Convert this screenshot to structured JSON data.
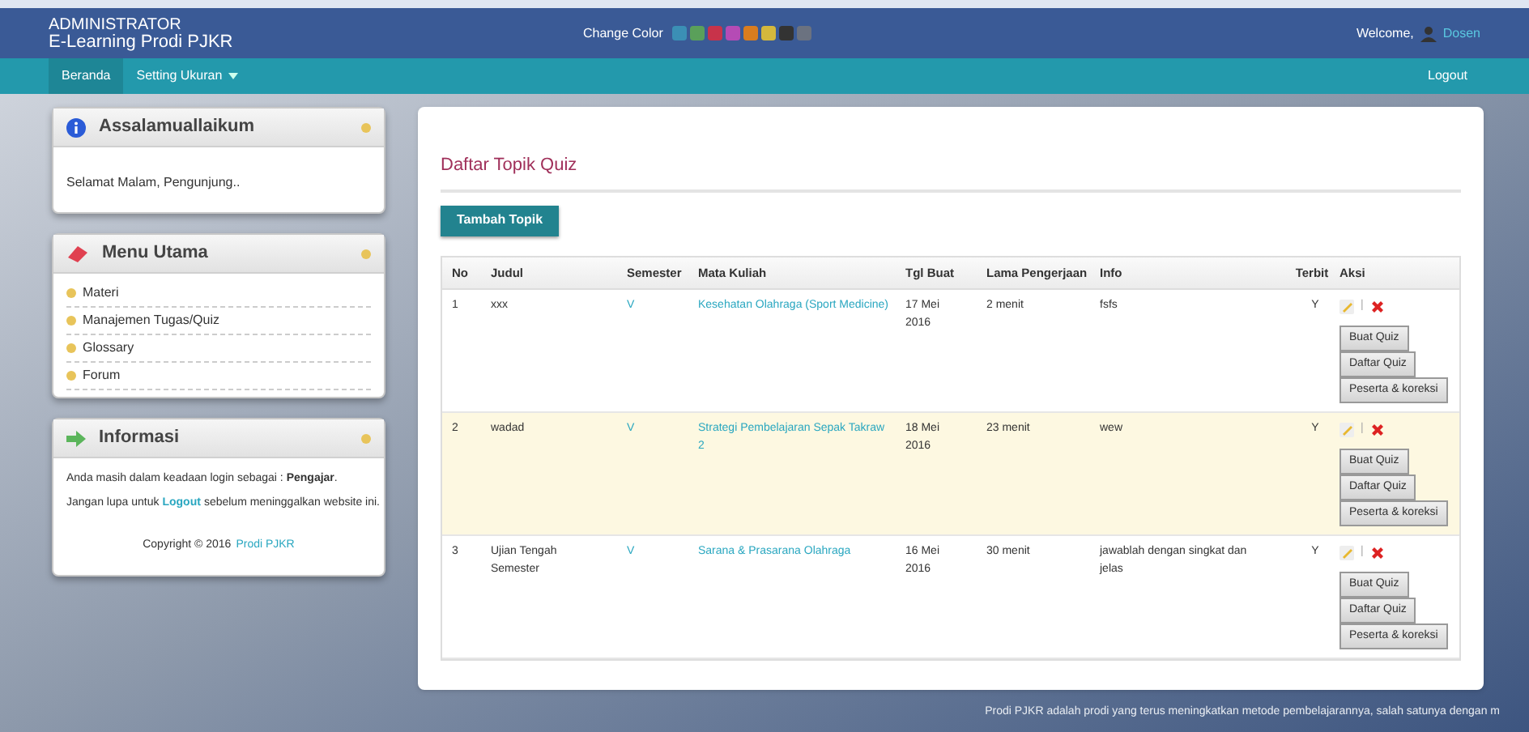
{
  "header": {
    "role": "ADMINISTRATOR",
    "app_name": "E-Learning Prodi PJKR",
    "change_color_label": "Change Color",
    "swatches": [
      {
        "color": "#3b8fb5"
      },
      {
        "color": "#5aa05a"
      },
      {
        "color": "#c8334a"
      },
      {
        "color": "#b54bb5"
      },
      {
        "color": "#d97d1f"
      },
      {
        "color": "#d4b83c"
      },
      {
        "color": "#333333"
      },
      {
        "color": "#6b7280"
      }
    ],
    "welcome": "Welcome,",
    "user": "Dosen"
  },
  "nav": {
    "items": [
      {
        "label": "Beranda",
        "selected": true,
        "dropdown": false
      },
      {
        "label": "Setting Ukuran",
        "selected": false,
        "dropdown": true
      }
    ],
    "logout": "Logout"
  },
  "sidebar": [
    {
      "kind": "text",
      "title": "Assalamuallaikum",
      "body": "Selamat Malam, Pengunjung.."
    },
    {
      "kind": "menu",
      "title": "Menu Utama",
      "items": [
        "Materi",
        "Manajemen Tugas/Quiz",
        "Glossary",
        "Forum"
      ]
    },
    {
      "kind": "info",
      "title": "Informasi",
      "line1": "Anda masih dalam keadaan login sebagai : **Pengajar**.",
      "line2_before": "Jangan lupa untuk",
      "line2_link": "Logout",
      "line2_after": "sebelum meninggalkan website ini.",
      "copyright": "Copyright © 2016",
      "copyright_link": "Prodi PJKR"
    }
  ],
  "main": {
    "title": "Daftar Topik Quiz",
    "add_button": "Tambah Topik",
    "table": {
      "columns": [
        "No",
        "Judul",
        "Semester",
        "Mata Kuliah",
        "Tgl Buat",
        "Lama Pengerjaan",
        "Info",
        "Terbit",
        "Aksi"
      ],
      "rows": [
        {
          "no": "1",
          "judul": "xxx",
          "semester": "V",
          "mata_kuliah": "Kesehatan Olahraga (Sport Medicine)",
          "tgl": "17 Mei 2016",
          "lama": "2 menit",
          "info": "fsfs",
          "terbit": "Y",
          "highlighted": false,
          "separator": "|",
          "actions": [
            "Buat Quiz",
            "Daftar Quiz",
            "Peserta & koreksi"
          ]
        },
        {
          "no": "2",
          "judul": "wadad",
          "semester": "V",
          "mata_kuliah": "Strategi Pembelajaran Sepak Takraw 2",
          "tgl": "18 Mei 2016",
          "lama": "23 menit",
          "info": "wew",
          "terbit": "Y",
          "highlighted": true,
          "separator": "|",
          "actions": [
            "Buat Quiz",
            "Daftar Quiz",
            "Peserta & koreksi"
          ]
        },
        {
          "no": "3",
          "judul": "Ujian Tengah Semester",
          "semester": "V",
          "mata_kuliah": "Sarana & Prasarana Olahraga",
          "tgl": "16 Mei 2016",
          "lama": "30 menit",
          "info": "jawablah dengan singkat dan jelas",
          "terbit": "Y",
          "highlighted": false,
          "separator": "|",
          "actions": [
            "Buat Quiz",
            "Daftar Quiz",
            "Peserta & koreksi"
          ]
        }
      ]
    }
  },
  "footer": "Prodi PJKR adalah prodi yang terus meningkatkan metode pembelajarannya, salah satunya dengan m"
}
